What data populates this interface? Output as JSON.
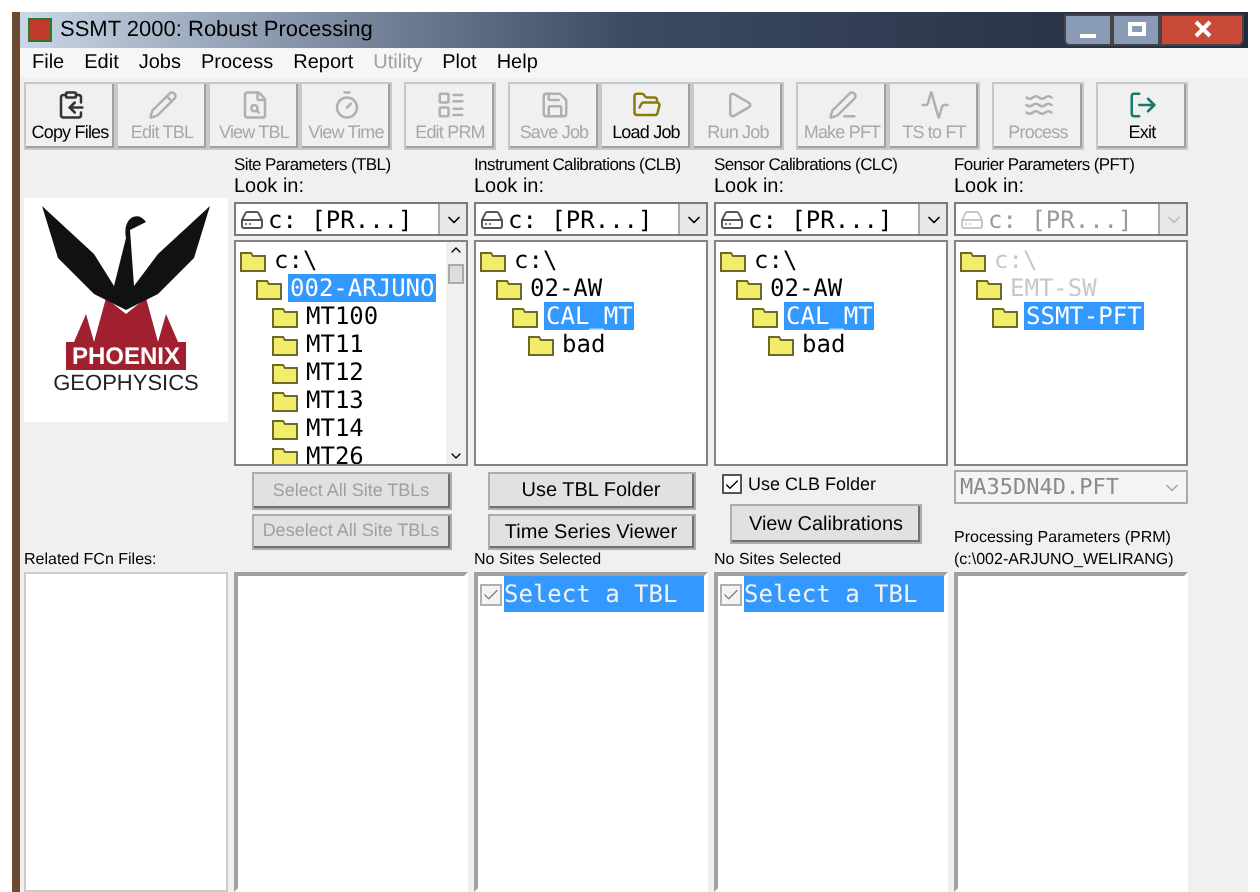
{
  "window": {
    "title": "SSMT 2000: Robust Processing"
  },
  "menu": [
    {
      "label": "File",
      "disabled": false
    },
    {
      "label": "Edit",
      "disabled": false
    },
    {
      "label": "Jobs",
      "disabled": false
    },
    {
      "label": "Process",
      "disabled": false
    },
    {
      "label": "Report",
      "disabled": false
    },
    {
      "label": "Utility",
      "disabled": true
    },
    {
      "label": "Plot",
      "disabled": false
    },
    {
      "label": "Help",
      "disabled": false
    }
  ],
  "toolbar": [
    {
      "label": "Copy Files",
      "disabled": false
    },
    {
      "label": "Edit TBL",
      "disabled": true
    },
    {
      "label": "View TBL",
      "disabled": true
    },
    {
      "label": "View Time",
      "disabled": true
    },
    {
      "label": "Edit PRM",
      "disabled": true
    },
    {
      "label": "Save Job",
      "disabled": true
    },
    {
      "label": "Load Job",
      "disabled": false
    },
    {
      "label": "Run Job",
      "disabled": true
    },
    {
      "label": "Make PFT",
      "disabled": true
    },
    {
      "label": "TS to FT",
      "disabled": true
    },
    {
      "label": "Process",
      "disabled": true
    },
    {
      "label": "Exit",
      "disabled": false
    }
  ],
  "logo": {
    "name": "PHOENIX",
    "subtitle": "GEOPHYSICS"
  },
  "panels": [
    {
      "title": "Site Parameters (TBL)",
      "look_in": "Look in:",
      "drive": "c: [PR...]",
      "disabled": false,
      "scrollbar": true,
      "tree": [
        {
          "label": "c:\\",
          "selected": false,
          "children": [
            {
              "label": "002-ARJUNO",
              "selected": true,
              "children": [
                {
                  "label": "MT100",
                  "selected": false
                },
                {
                  "label": "MT11",
                  "selected": false
                },
                {
                  "label": "MT12",
                  "selected": false
                },
                {
                  "label": "MT13",
                  "selected": false
                },
                {
                  "label": "MT14",
                  "selected": false
                },
                {
                  "label": "MT26",
                  "selected": false
                }
              ]
            }
          ]
        }
      ]
    },
    {
      "title": "Instrument Calibrations (CLB)",
      "look_in": "Look in:",
      "drive": "c: [PR...]",
      "disabled": false,
      "scrollbar": false,
      "tree": [
        {
          "label": "c:\\",
          "selected": false,
          "children": [
            {
              "label": "02-AW",
              "selected": false,
              "children": [
                {
                  "label": "CAL_MT",
                  "selected": true,
                  "children": [
                    {
                      "label": "bad",
                      "selected": false
                    }
                  ]
                }
              ]
            }
          ]
        }
      ]
    },
    {
      "title": "Sensor Calibrations (CLC)",
      "look_in": "Look in:",
      "drive": "c: [PR...]",
      "disabled": false,
      "scrollbar": false,
      "tree": [
        {
          "label": "c:\\",
          "selected": false,
          "children": [
            {
              "label": "02-AW",
              "selected": false,
              "children": [
                {
                  "label": "CAL_MT",
                  "selected": true,
                  "children": [
                    {
                      "label": "bad",
                      "selected": false
                    }
                  ]
                }
              ]
            }
          ]
        }
      ]
    },
    {
      "title": "Fourier Parameters (PFT)",
      "look_in": "Look in:",
      "drive": "c: [PR...]",
      "disabled": true,
      "scrollbar": false,
      "tree": [
        {
          "label": "c:\\",
          "selected": false,
          "disabled": true,
          "children": [
            {
              "label": "EMT-SW",
              "selected": false,
              "disabled": true,
              "children": [
                {
                  "label": "SSMT-PFT",
                  "selected": true,
                  "disabled": false
                }
              ]
            }
          ]
        }
      ]
    }
  ],
  "tbl_buttons": [
    {
      "label": "Select All Site TBLs",
      "disabled": true
    },
    {
      "label": "Deselect All Site TBLs",
      "disabled": true
    }
  ],
  "clb_buttons": [
    {
      "label": "Use TBL Folder",
      "disabled": false
    },
    {
      "label": "Time Series Viewer",
      "disabled": false
    }
  ],
  "use_clb_folder": {
    "label": "Use CLB Folder",
    "checked": true
  },
  "clc_buttons": [
    {
      "label": "View Calibrations",
      "disabled": false
    }
  ],
  "pft_file": {
    "value": "MA35DN4D.PFT"
  },
  "related_label": "Related FCn Files:",
  "clb_status": "No Sites Selected",
  "clc_status": "No Sites Selected",
  "prm_label": "Processing Parameters (PRM)",
  "prm_path": "(c:\\002-ARJUNO_WELIRANG)",
  "clb_list": [
    {
      "label": "Select a TBL",
      "checked": true,
      "selected": true
    }
  ],
  "clc_list": [
    {
      "label": "Select a TBL",
      "checked": true,
      "selected": true
    }
  ]
}
